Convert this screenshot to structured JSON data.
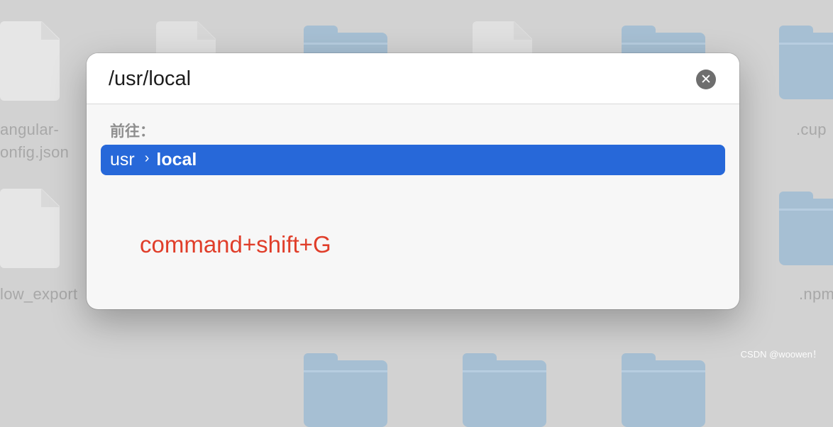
{
  "background": {
    "labels": [
      "angular-",
      "onfig.json",
      "low_export",
      ".cup",
      ".npm"
    ],
    "icons": [
      "document-icon",
      "document-icon",
      "folder-icon",
      "document-icon",
      "folder-icon",
      "folder-icon",
      "document-icon",
      "folder-icon"
    ]
  },
  "dialog": {
    "path_value": "/usr/local",
    "clear_icon": "close-circle-icon",
    "goto_label": "前往：",
    "suggestion": {
      "parent": "usr",
      "separator": "›",
      "current": "local",
      "highlight_color": "#2768d9"
    }
  },
  "annotation": {
    "text": "command+shift+G",
    "color": "#e03e2a"
  },
  "watermark": "CSDN @woowen！"
}
